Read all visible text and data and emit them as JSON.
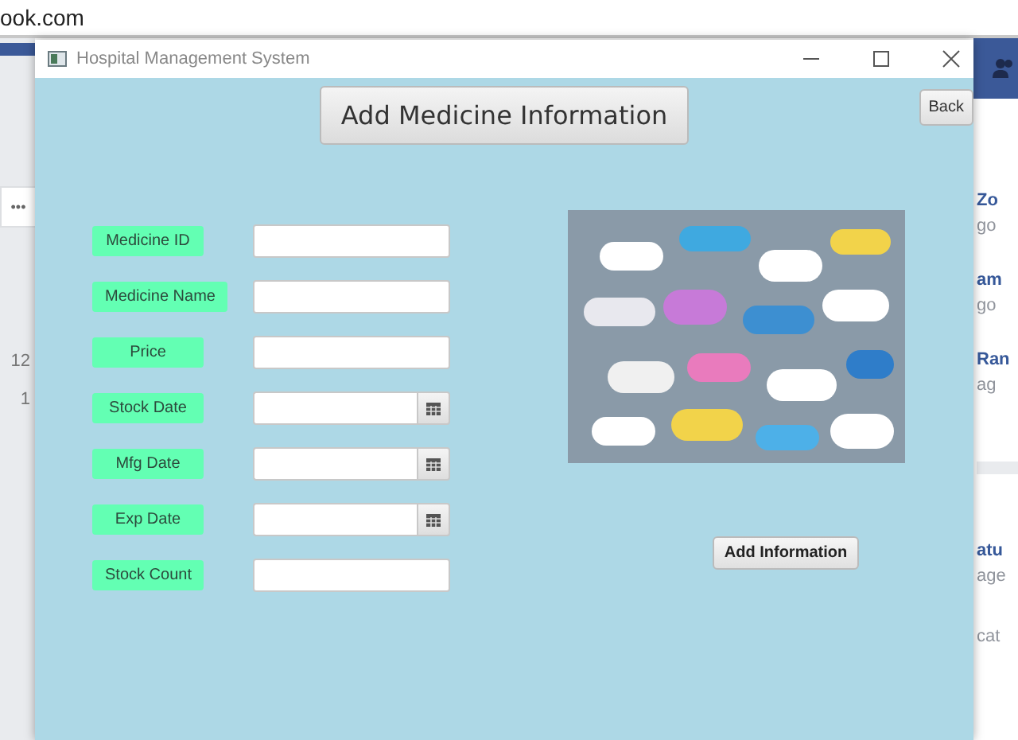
{
  "browser": {
    "address": "ook.com",
    "more_button": "•••",
    "left_counts": [
      "12",
      "1"
    ],
    "right_items": [
      {
        "kind": "name",
        "text": "Zo"
      },
      {
        "kind": "meta",
        "text": "go"
      },
      {
        "kind": "name",
        "text": "am"
      },
      {
        "kind": "meta",
        "text": "go"
      },
      {
        "kind": "name",
        "text": "Ran"
      },
      {
        "kind": "meta",
        "text": "ag"
      },
      {
        "kind": "gap"
      },
      {
        "kind": "name",
        "text": "atu"
      },
      {
        "kind": "meta",
        "text": "age"
      },
      {
        "kind": "meta",
        "text": "cat"
      }
    ]
  },
  "window": {
    "title": "Hospital Management System"
  },
  "heading": "Add Medicine Information",
  "back_button": "Back",
  "fields": [
    {
      "label": "Medicine ID",
      "kind": "text"
    },
    {
      "label": "Medicine Name",
      "kind": "text"
    },
    {
      "label": "Price",
      "kind": "text"
    },
    {
      "label": "Stock Date",
      "kind": "date"
    },
    {
      "label": "Mfg Date",
      "kind": "date"
    },
    {
      "label": "Exp Date",
      "kind": "date"
    },
    {
      "label": "Stock Count",
      "kind": "text"
    }
  ],
  "submit_button": "Add Information"
}
